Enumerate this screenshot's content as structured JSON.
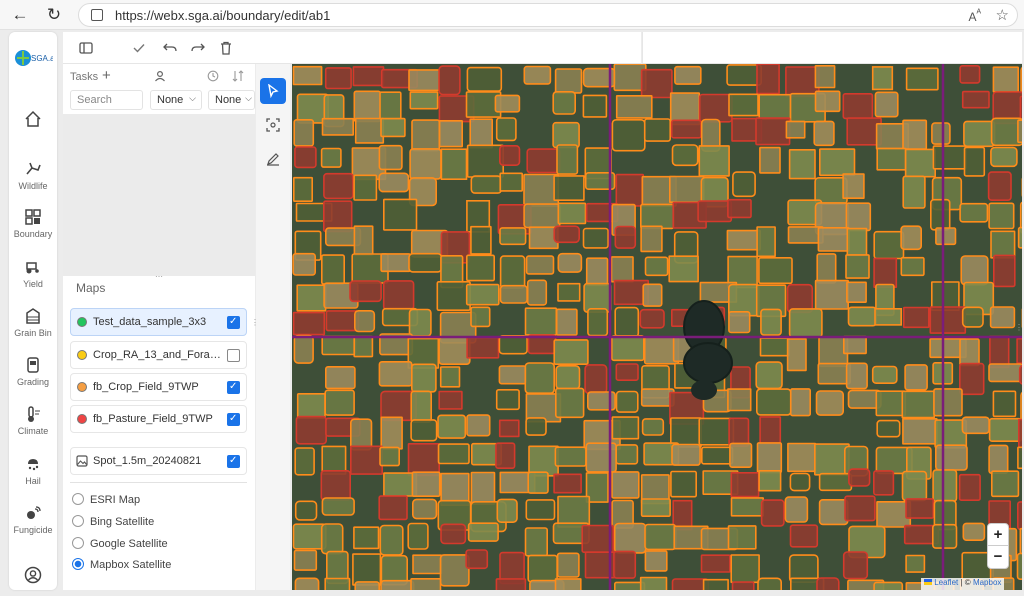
{
  "browser": {
    "url": "https://webx.sga.ai/boundary/edit/ab1"
  },
  "rail": {
    "logo": "SGA.ai",
    "items": [
      {
        "label": "",
        "icon": "home-icon"
      },
      {
        "label": "Wildlife",
        "icon": "deer-icon"
      },
      {
        "label": "Boundary",
        "icon": "grid-icon"
      },
      {
        "label": "Yield",
        "icon": "tractor-icon"
      },
      {
        "label": "Grain Bin",
        "icon": "grain-bin-icon"
      },
      {
        "label": "Grading",
        "icon": "grading-icon"
      },
      {
        "label": "Climate",
        "icon": "thermometer-icon"
      },
      {
        "label": "Hail",
        "icon": "hail-icon"
      },
      {
        "label": "Fungicide",
        "icon": "fungicide-icon"
      }
    ]
  },
  "tasks": {
    "title": "Tasks",
    "search_placeholder": "Search",
    "filter1": "None",
    "filter2": "None"
  },
  "maps": {
    "title": "Maps",
    "layers": [
      {
        "label": "Test_data_sample_3x3",
        "color": "#22c55e",
        "checked": true,
        "selected": true
      },
      {
        "label": "Crop_RA_13_and_Forage_...",
        "color": "#facc15",
        "checked": false,
        "selected": false
      },
      {
        "label": "fb_Crop_Field_9TWP",
        "color": "#f59e42",
        "checked": true,
        "selected": false
      },
      {
        "label": "fb_Pasture_Field_9TWP",
        "color": "#ef4444",
        "checked": true,
        "selected": false
      },
      {
        "label": "Spot_1.5m_20240821",
        "color": "",
        "checked": true,
        "selected": false
      }
    ],
    "basemaps": [
      {
        "label": "ESRI Map",
        "selected": false
      },
      {
        "label": "Bing Satellite",
        "selected": false
      },
      {
        "label": "Google Satellite",
        "selected": false
      },
      {
        "label": "Mapbox Satellite",
        "selected": true
      }
    ]
  },
  "map": {
    "attribution_leaflet": "Leaflet",
    "attribution_sep": "| ©",
    "attribution_mapbox": "Mapbox",
    "zoom_in": "+",
    "zoom_out": "−"
  },
  "colors": {
    "accent": "#1a73e8",
    "crop_outline": "#ff8c1a",
    "pasture_fill": "#d43a2c",
    "grid_line": "#7a1d7a"
  }
}
